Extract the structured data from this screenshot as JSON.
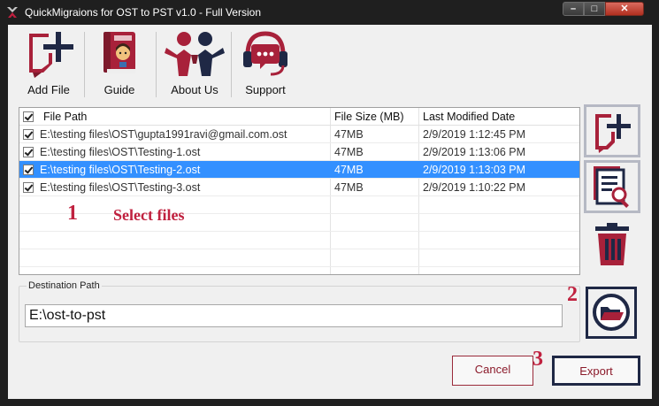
{
  "window": {
    "title": "QuickMigraions for OST to PST v1.0 - Full Version",
    "controls": [
      "minimize",
      "maximize",
      "close"
    ]
  },
  "toolbar": {
    "items": [
      {
        "label": "Add File",
        "icon": "add-file-icon"
      },
      {
        "label": "Guide",
        "icon": "guide-book-icon"
      },
      {
        "label": "About Us",
        "icon": "about-us-icon"
      },
      {
        "label": "Support",
        "icon": "support-headset-icon"
      }
    ]
  },
  "file_table": {
    "columns": [
      "File Path",
      "File Size (MB)",
      "Last Modified Date"
    ],
    "header_checked": true,
    "rows": [
      {
        "path": "E:\\testing files\\OST\\gupta1991ravi@gmail.com.ost",
        "size": "47MB",
        "modified": "2/9/2019 1:12:45 PM",
        "checked": true,
        "selected": false
      },
      {
        "path": "E:\\testing files\\OST\\Testing-1.ost",
        "size": "47MB",
        "modified": "2/9/2019 1:13:06 PM",
        "checked": true,
        "selected": false
      },
      {
        "path": "E:\\testing files\\OST\\Testing-2.ost",
        "size": "47MB",
        "modified": "2/9/2019 1:13:03 PM",
        "checked": true,
        "selected": true
      },
      {
        "path": "E:\\testing files\\OST\\Testing-3.ost",
        "size": "47MB",
        "modified": "2/9/2019 1:10:22 PM",
        "checked": true,
        "selected": false
      }
    ]
  },
  "annotations": {
    "step1_number": "1",
    "step1_text": "Select files",
    "step2_number": "2",
    "step3_number": "3"
  },
  "side_buttons": [
    {
      "icon": "add-file-icon"
    },
    {
      "icon": "preview-search-icon"
    },
    {
      "icon": "trash-icon"
    },
    {
      "icon": "folder-open-icon"
    }
  ],
  "destination": {
    "label": "Destination Path",
    "value": "E:\\ost-to-pst"
  },
  "buttons": {
    "cancel": "Cancel",
    "export": "Export"
  },
  "colors": {
    "brand": "#a8213a",
    "navy": "#1f2845",
    "selection": "#3390ff"
  }
}
